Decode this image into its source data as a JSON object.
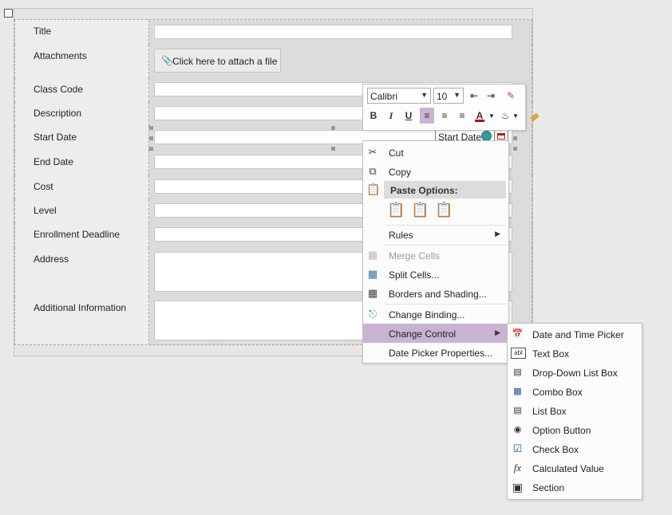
{
  "form": {
    "rows": [
      {
        "label": "Title"
      },
      {
        "label": "Attachments"
      },
      {
        "label": "Class Code"
      },
      {
        "label": "Description"
      },
      {
        "label": "Start Date"
      },
      {
        "label": "End Date"
      },
      {
        "label": "Cost"
      },
      {
        "label": "Level"
      },
      {
        "label": "Enrollment Deadline"
      },
      {
        "label": "Address"
      },
      {
        "label": "Additional Information"
      }
    ],
    "attach_button": "Click here to attach a file",
    "start_date_control": "Start Date"
  },
  "mini_toolbar": {
    "font": "Calibri",
    "size": "10",
    "buttons": [
      "decrease-indent",
      "increase-indent",
      "clear-formatting",
      "bold",
      "italic",
      "underline",
      "align-left",
      "align-center",
      "align-right",
      "font-color",
      "highlight",
      "format-painter"
    ],
    "bold_label": "B",
    "italic_label": "I",
    "underline_label": "U",
    "font_color_label": "A"
  },
  "context_menu": {
    "cut": "Cut",
    "copy": "Copy",
    "paste_options": "Paste Options:",
    "rules": "Rules",
    "merge_cells": "Merge Cells",
    "split_cells": "Split Cells...",
    "borders_shading": "Borders and Shading...",
    "change_binding": "Change Binding...",
    "change_control": "Change Control",
    "date_picker_props": "Date Picker Properties..."
  },
  "submenu": {
    "items": [
      {
        "label": "Date and Time Picker",
        "icon": "date-time-picker-icon"
      },
      {
        "label": "Text Box",
        "icon": "text-box-icon"
      },
      {
        "label": "Drop-Down List Box",
        "icon": "dropdown-list-icon"
      },
      {
        "label": "Combo Box",
        "icon": "combo-box-icon"
      },
      {
        "label": "List Box",
        "icon": "list-box-icon"
      },
      {
        "label": "Option Button",
        "icon": "option-button-icon"
      },
      {
        "label": "Check Box",
        "icon": "check-box-icon"
      },
      {
        "label": "Calculated Value",
        "icon": "calculated-value-icon"
      },
      {
        "label": "Section",
        "icon": "section-icon"
      }
    ]
  },
  "colors": {
    "highlight": "#c9b3d3",
    "font_color_bar": "#c00000"
  }
}
